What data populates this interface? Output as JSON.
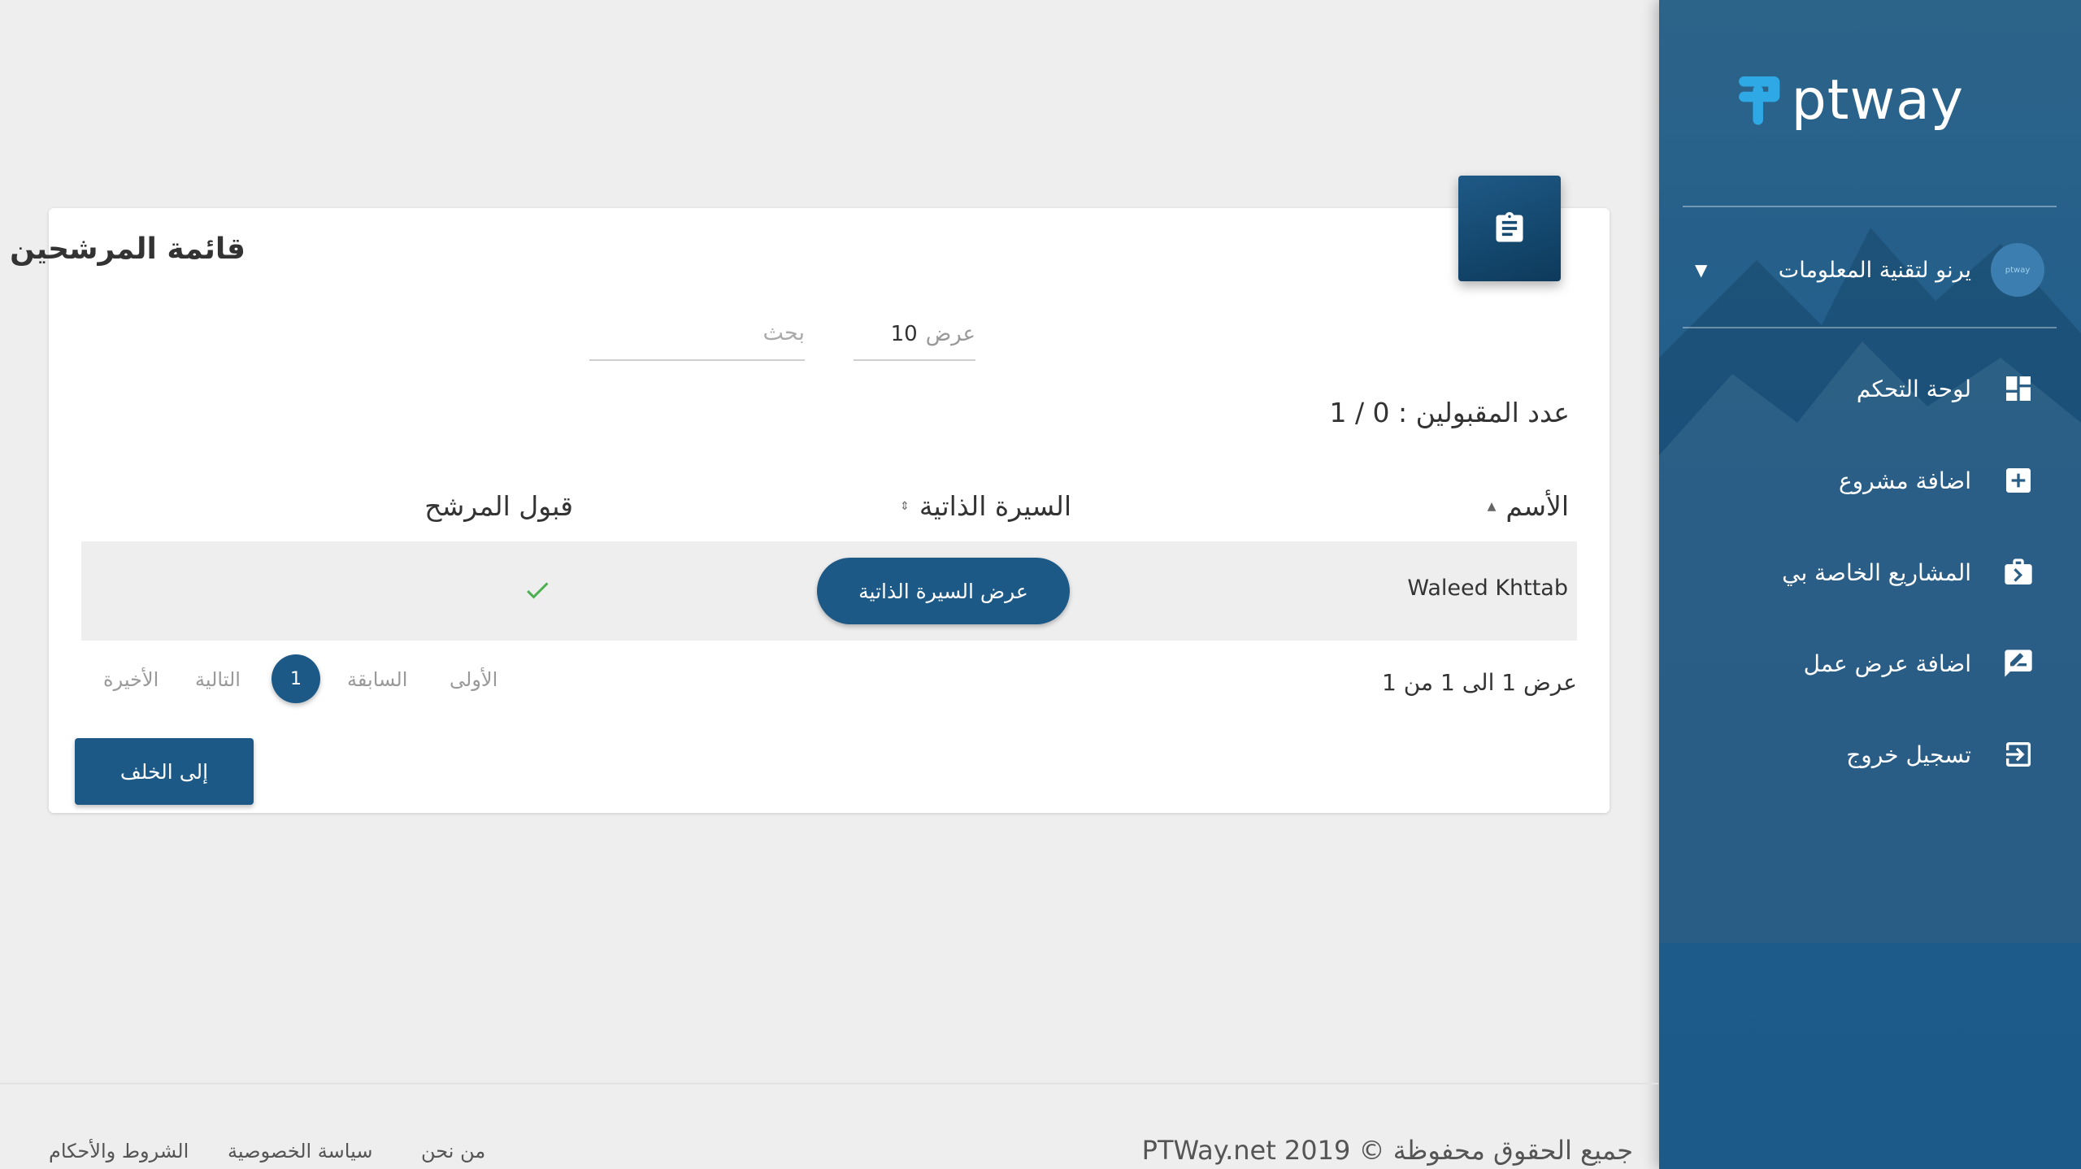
{
  "brand": {
    "name": "ptway",
    "avatar_text": "ptway"
  },
  "sidebar": {
    "company_name": "يرنو لتقنية المعلومات",
    "items": [
      {
        "label": "لوحة التحكم",
        "icon": "dashboard-icon"
      },
      {
        "label": "اضافة مشروع",
        "icon": "add-box-icon"
      },
      {
        "label": "المشاريع الخاصة بي",
        "icon": "briefcase-icon"
      },
      {
        "label": "اضافة عرض عمل",
        "icon": "rate-review-icon"
      },
      {
        "label": "تسجيل خروج",
        "icon": "logout-icon"
      }
    ]
  },
  "card": {
    "title": "قائمة المرشحين",
    "icon": "clipboard-icon",
    "search_placeholder": "بحث",
    "show_label": "عرض",
    "show_value": "10",
    "accepted_label": "عدد المقبولين :",
    "accepted_value": "1 / 0"
  },
  "table": {
    "columns": [
      "الأسم",
      "السيرة الذاتية",
      "قبول المرشح"
    ],
    "rows": [
      {
        "name": "Waleed Khttab",
        "cv_button": "عرض السيرة الذاتية",
        "accepted": true
      }
    ]
  },
  "pagination": {
    "info": "عرض 1 الى 1 من 1",
    "first": "الأولى",
    "previous": "السابقة",
    "current": "1",
    "next": "التالية",
    "last": "الأخيرة"
  },
  "back_button": "إلى الخلف",
  "footer": {
    "copyright": "جميع الحقوق محفوظة © 2019 PTWay.net",
    "links": [
      "من نحن",
      "سياسة الخصوصية",
      "الشروط والأحكام"
    ]
  },
  "colors": {
    "primary": "#1c5987",
    "sidebar": "#1f5d8c",
    "accept": "#4caf50",
    "logo_accent": "#2fa8e6"
  }
}
